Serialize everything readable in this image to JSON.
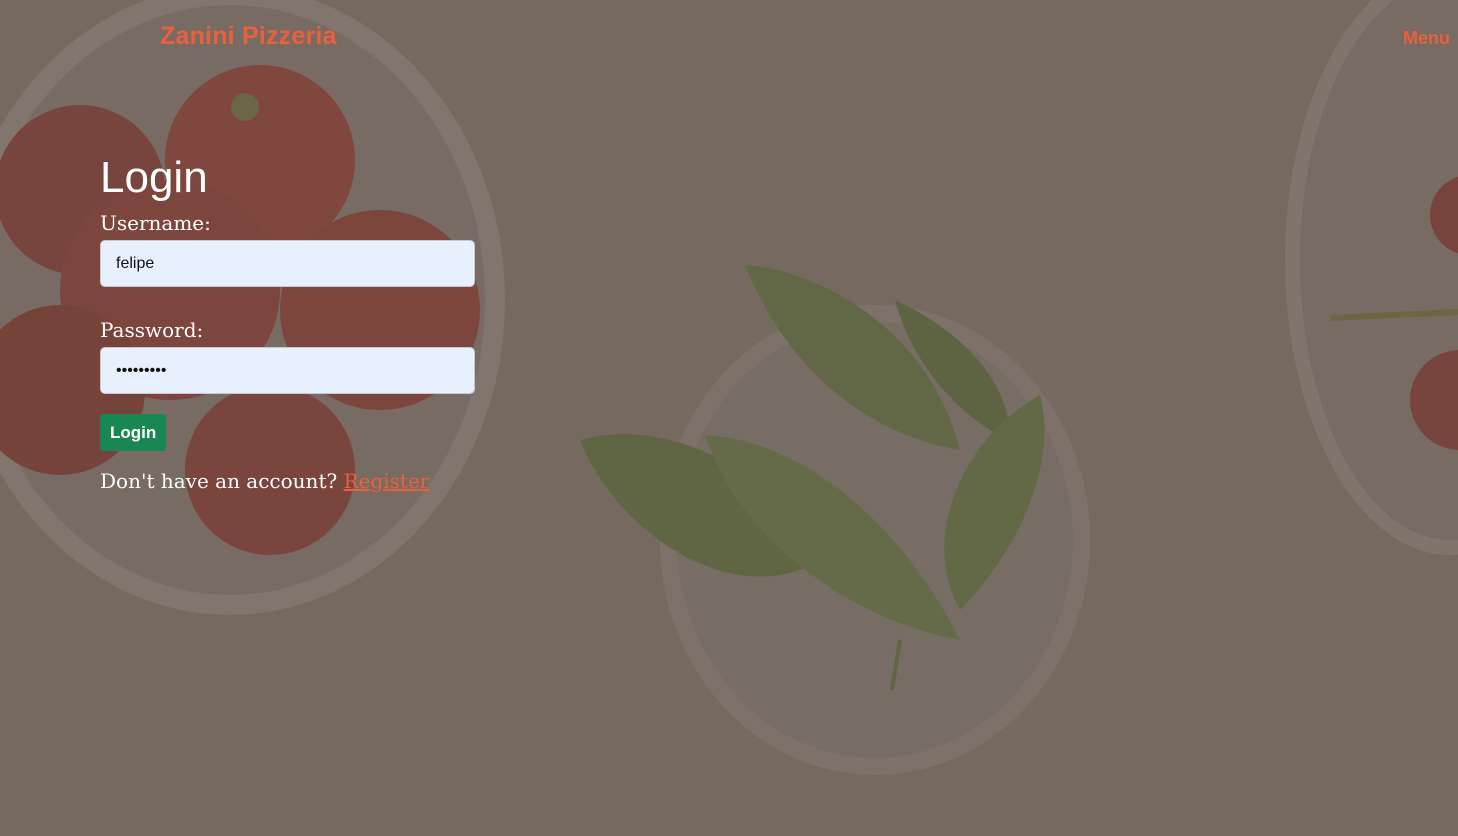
{
  "header": {
    "brand": "Zanini Pizzeria",
    "menu_label": "Menu"
  },
  "login": {
    "title": "Login",
    "username_label": "Username:",
    "username_value": "felipe",
    "password_label": "Password:",
    "password_value": "•••••••••",
    "button_label": "Login",
    "no_account_text": "Don't have an account?",
    "register_label": "Register"
  },
  "colors": {
    "accent": "#e8603c",
    "button": "#198754",
    "input_bg": "#e8f0fe"
  }
}
